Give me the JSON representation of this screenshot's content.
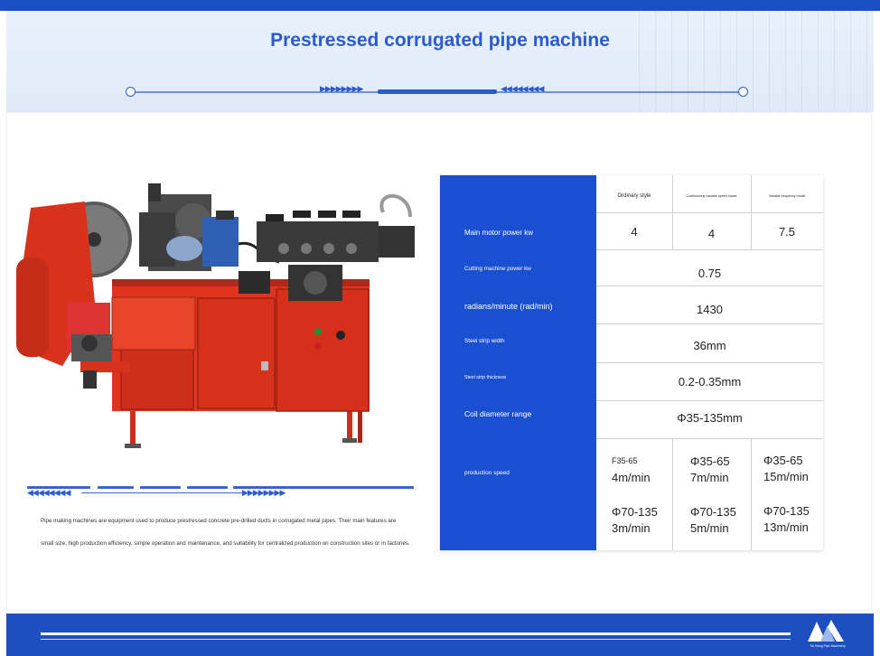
{
  "title": "Prestressed corrugated pipe machine",
  "header_arrows": {
    "right": "▶▶▶▶▶▶▶▶",
    "left": "◀◀◀◀◀◀◀◀"
  },
  "table": {
    "header": [
      "Ordinary style",
      "Continuously variable speed model",
      "Variable frequency model"
    ],
    "rows": {
      "main_motor": {
        "label": "Main motor power kw",
        "values": [
          "4",
          "4",
          "7.5"
        ]
      },
      "cutting": {
        "label": "Cutting machine power kw",
        "value": "0.75"
      },
      "radians": {
        "label": "radians/minute (rad/min)",
        "value": "1430"
      },
      "width": {
        "label": "Steel strip width",
        "value": "36mm"
      },
      "thickness": {
        "label": "Steel strip thickness",
        "value": "0.2-0.35mm"
      },
      "coil": {
        "label": "Coil diameter range",
        "value": "Φ35-135mm"
      },
      "speed": {
        "label": "production speed",
        "col1": {
          "top_range": "F35-65",
          "top_speed": "4m/min",
          "bottom_range": "Φ70-135",
          "bottom_speed": "3m/min"
        },
        "col2": {
          "top_range": "Φ35-65",
          "top_speed": "7m/min",
          "bottom_range": "Φ70-135",
          "bottom_speed": "5m/min"
        },
        "col3": {
          "top_range": "Φ35-65",
          "top_speed": "15m/min",
          "bottom_range": "Φ70-135",
          "bottom_speed": "13m/min"
        }
      }
    }
  },
  "description": {
    "line1": "Pipe making machines are equipment used to produce prestressed concrete pre-drilled ducts in corrugated metal pipes. Their main features are",
    "line2": "small size, high production efficiency, simple operation and maintenance, and suitability for centralized production on construction sites or in factories."
  },
  "logo_tag": "Tai Xiang Pipe Machinery",
  "colors": {
    "brand_blue": "#1b4fd1",
    "machine_red": "#e0341f"
  }
}
